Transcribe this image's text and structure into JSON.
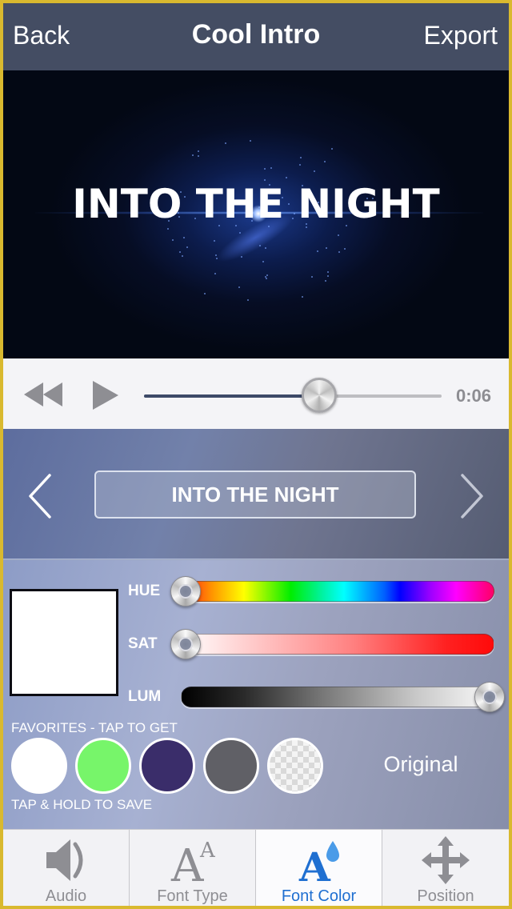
{
  "navbar": {
    "back_label": "Back",
    "title": "Cool Intro",
    "export_label": "Export"
  },
  "preview": {
    "headline": "INTO THE NIGHT"
  },
  "playback": {
    "rewind_icon": "rewind-icon",
    "play_icon": "play-icon",
    "progress_fraction": 0.59,
    "time": "0:06"
  },
  "text_selector": {
    "prev_icon": "chevron-left-icon",
    "next_icon": "chevron-right-icon",
    "current_text": "INTO THE NIGHT"
  },
  "color_editor": {
    "selected_color": "#ffffff",
    "sliders": [
      {
        "label": "HUE",
        "value_fraction": 0.0
      },
      {
        "label": "SAT",
        "value_fraction": 0.0
      },
      {
        "label": "LUM",
        "value_fraction": 1.0
      }
    ],
    "favorites_label": "FAVORITES - TAP TO GET",
    "save_hint": "TAP & HOLD TO SAVE",
    "favorites": [
      {
        "name": "white",
        "color": "#ffffff"
      },
      {
        "name": "green",
        "color": "#77f56a"
      },
      {
        "name": "indigo",
        "color": "#3a2d6a"
      },
      {
        "name": "gray",
        "color": "#606066"
      },
      {
        "name": "transparent",
        "color": "transparent"
      }
    ],
    "original_label": "Original"
  },
  "tabs": [
    {
      "label": "Audio",
      "icon": "speaker-icon",
      "active": false
    },
    {
      "label": "Font Type",
      "icon": "font-size-icon",
      "active": false
    },
    {
      "label": "Font Color",
      "icon": "font-color-icon",
      "active": true
    },
    {
      "label": "Position",
      "icon": "move-arrows-icon",
      "active": false
    }
  ],
  "colors": {
    "navbar_bg": "#444d63",
    "accent": "#1f6fd1",
    "inactive_tab": "#8e8e93"
  }
}
